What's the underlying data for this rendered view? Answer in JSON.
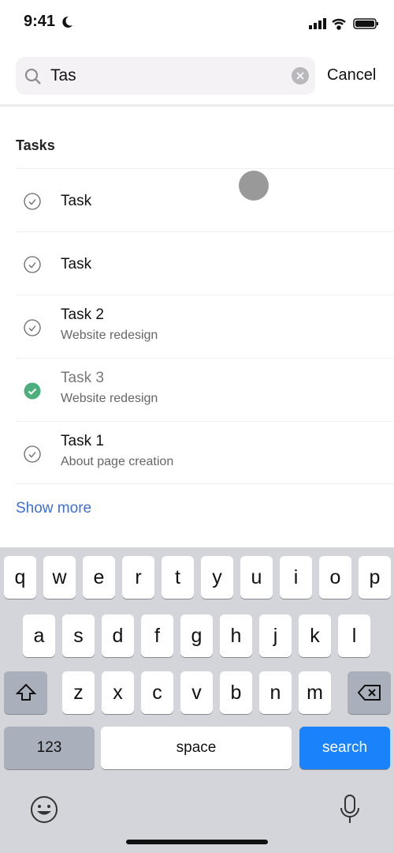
{
  "status": {
    "time": "9:41"
  },
  "search": {
    "value": "Tas",
    "cancel": "Cancel"
  },
  "section_title": "Tasks",
  "tasks": [
    {
      "title": "Task",
      "subtitle": "",
      "done": false
    },
    {
      "title": "Task",
      "subtitle": "",
      "done": false
    },
    {
      "title": "Task 2",
      "subtitle": "Website redesign",
      "done": false
    },
    {
      "title": "Task 3",
      "subtitle": "Website redesign",
      "done": true
    },
    {
      "title": "Task 1",
      "subtitle": "About page creation",
      "done": false
    }
  ],
  "show_more": "Show more",
  "keyboard": {
    "row1": [
      "q",
      "w",
      "e",
      "r",
      "t",
      "y",
      "u",
      "i",
      "o",
      "p"
    ],
    "row2": [
      "a",
      "s",
      "d",
      "f",
      "g",
      "h",
      "j",
      "k",
      "l"
    ],
    "row3": [
      "z",
      "x",
      "c",
      "v",
      "b",
      "n",
      "m"
    ],
    "numbers": "123",
    "space": "space",
    "search": "search"
  },
  "colors": {
    "accent": "#1a82fb",
    "done": "#4caf7d",
    "link": "#3f6fd0"
  }
}
